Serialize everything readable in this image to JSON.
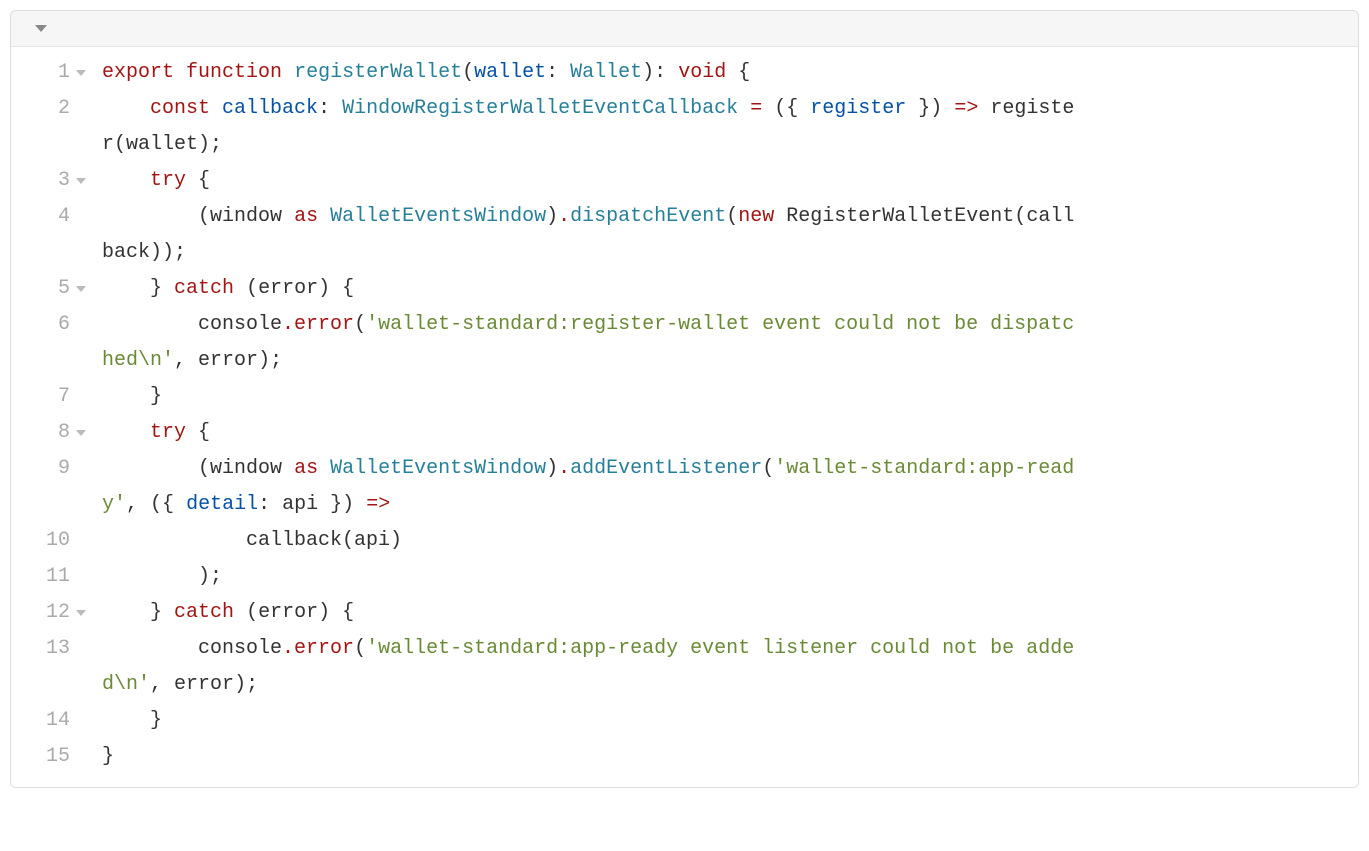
{
  "toolbar": {},
  "code": {
    "line_numbers": [
      "1",
      "2",
      "3",
      "4",
      "5",
      "6",
      "7",
      "8",
      "9",
      "10",
      "11",
      "12",
      "13",
      "14",
      "15"
    ],
    "foldable_lines": [
      1,
      3,
      5,
      8,
      12
    ],
    "tokens": {
      "export": "export",
      "function": "function",
      "registerWallet": "registerWallet",
      "wallet": "wallet",
      "Wallet": "Wallet",
      "void": "void",
      "const": "const",
      "callback": "callback",
      "WindowRegisterWalletEventCallback": "WindowRegisterWalletEventCallback",
      "register": "register",
      "registe": "registe",
      "r_wallet_close": "r(wallet);",
      "try": "try",
      "window": "window",
      "as": "as",
      "WalletEventsWindow": "WalletEventsWindow",
      "dispatchEvent": "dispatchEvent",
      "new": "new",
      "RegisterWalletEvent": "RegisterWalletEvent",
      "call": "call",
      "back_close": "back));",
      "catch": "catch",
      "error_param": "error",
      "console": "console",
      "error_method": "error",
      "string1a": "'wallet-standard:register-wallet event could not be dispatc",
      "string1b": "hed\\n'",
      "string2a": "'wallet-standard:app-read",
      "string2b_prefix": "y'",
      "detail": "detail",
      "api": "api",
      "addEventListener": "addEventListener",
      "callback_api": "callback(api)",
      "string3a": "'wallet-standard:app-ready event listener could not be adde",
      "string3b": "d\\n'"
    }
  }
}
